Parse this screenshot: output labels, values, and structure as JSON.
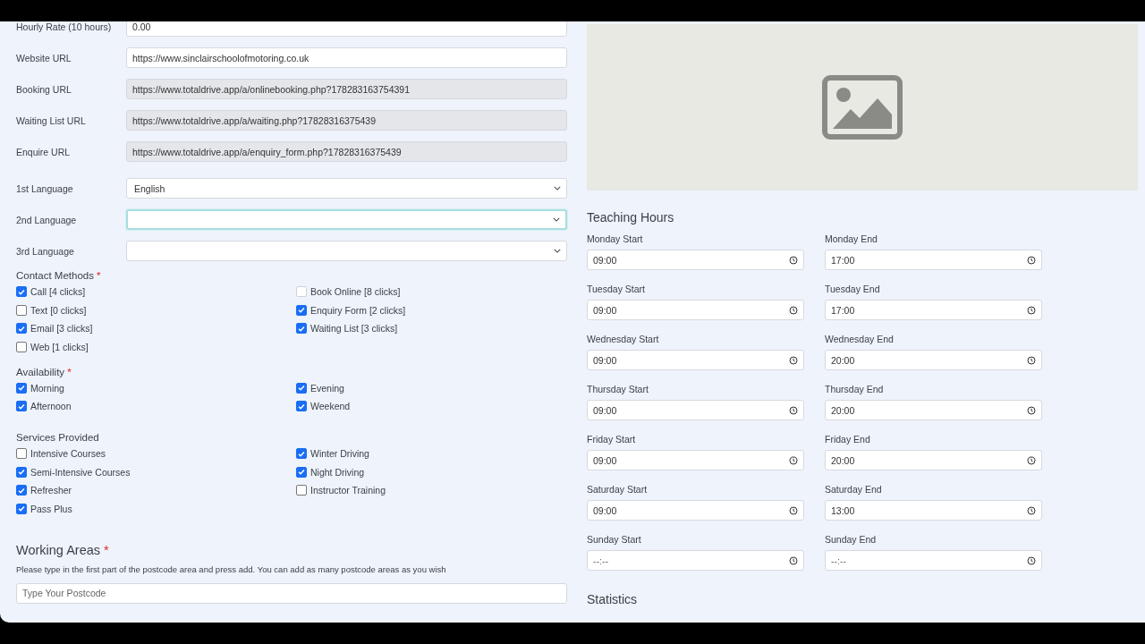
{
  "url_fields": [
    {
      "label": "Hourly Rate (10 hours)",
      "value": "0.00",
      "readonly": false
    },
    {
      "label": "Website URL",
      "value": "https://www.sinclairschoolofmotoring.co.uk",
      "readonly": false
    },
    {
      "label": "Booking URL",
      "value": "https://www.totaldrive.app/a/onlinebooking.php?178283163754391",
      "readonly": true
    },
    {
      "label": "Waiting List URL",
      "value": "https://www.totaldrive.app/a/waiting.php?17828316375439",
      "readonly": true
    },
    {
      "label": "Enquire URL",
      "value": "https://www.totaldrive.app/a/enquiry_form.php?17828316375439",
      "readonly": true
    }
  ],
  "languages": [
    {
      "label": "1st Language",
      "value": "English",
      "focused": false
    },
    {
      "label": "2nd Language",
      "focused": true
    },
    {
      "label": "3rd Language",
      "focused": false
    }
  ],
  "checkbox_groups": [
    {
      "title": "Contact Methods",
      "required_mark": "*",
      "options": [
        {
          "label": "Call [4 clicks]",
          "checked": true,
          "disabled": false
        },
        {
          "label": "Book Online [8 clicks]",
          "checked": false,
          "disabled": true
        },
        {
          "label": "Text [0 clicks]",
          "checked": false,
          "disabled": false
        },
        {
          "label": "Enquiry Form [2 clicks]",
          "checked": true,
          "disabled": false
        },
        {
          "label": "Email [3 clicks]",
          "checked": true,
          "disabled": false
        },
        {
          "label": "Waiting List [3 clicks]",
          "checked": true,
          "disabled": false
        },
        {
          "label": "Web [1 clicks]",
          "checked": false,
          "disabled": false
        }
      ]
    },
    {
      "title": "Availability",
      "required_mark": "*",
      "options": [
        {
          "label": "Morning",
          "checked": true,
          "disabled": false
        },
        {
          "label": "Evening",
          "checked": true,
          "disabled": false
        },
        {
          "label": "Afternoon",
          "checked": true,
          "disabled": false
        },
        {
          "label": "Weekend",
          "checked": true,
          "disabled": false
        }
      ]
    },
    {
      "title": "Services Provided",
      "options": [
        {
          "label": "Intensive Courses",
          "checked": false,
          "disabled": false
        },
        {
          "label": "Winter Driving",
          "checked": true,
          "disabled": false
        },
        {
          "label": "Semi-Intensive Courses",
          "checked": true,
          "disabled": false
        },
        {
          "label": "Night Driving",
          "checked": true,
          "disabled": false
        },
        {
          "label": "Refresher",
          "checked": true,
          "disabled": false
        },
        {
          "label": "Instructor Training",
          "checked": false,
          "disabled": false
        },
        {
          "label": "Pass Plus",
          "checked": true,
          "disabled": false
        }
      ]
    }
  ],
  "working_areas": {
    "title": "Working Areas",
    "required_mark": "*",
    "help": "Please type in the first part of the postcode area and press add. You can add as many postcode areas as you wish",
    "placeholder": "Type Your Postcode"
  },
  "teaching_hours": {
    "title": "Teaching Hours",
    "fields": [
      {
        "label": "Monday Start",
        "value": "09:00"
      },
      {
        "label": "Monday End",
        "value": "17:00"
      },
      {
        "label": "Tuesday Start",
        "value": "09:00"
      },
      {
        "label": "Tuesday End",
        "value": "17:00"
      },
      {
        "label": "Wednesday Start",
        "value": "09:00"
      },
      {
        "label": "Wednesday End",
        "value": "20:00"
      },
      {
        "label": "Thursday Start",
        "value": "09:00"
      },
      {
        "label": "Thursday End",
        "value": "20:00"
      },
      {
        "label": "Friday Start",
        "value": "09:00"
      },
      {
        "label": "Friday End",
        "value": "20:00"
      },
      {
        "label": "Saturday Start",
        "value": "09:00"
      },
      {
        "label": "Saturday End",
        "value": "13:00"
      },
      {
        "label": "Sunday Start",
        "value": "--:--"
      },
      {
        "label": "Sunday End",
        "value": "--:--"
      }
    ]
  },
  "statistics": {
    "title": "Statistics"
  }
}
